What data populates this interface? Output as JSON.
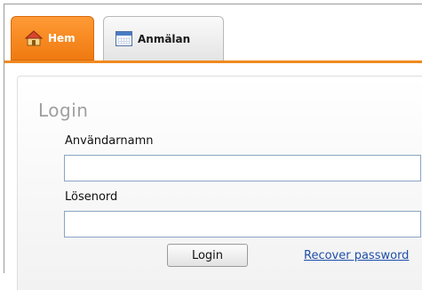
{
  "tabs": [
    {
      "label": "Hem",
      "icon": "house-icon",
      "active": true
    },
    {
      "label": "Anmälan",
      "icon": "calendar-icon",
      "active": false
    }
  ],
  "login": {
    "title": "Login",
    "username_label": "Användarnamn",
    "username_value": "",
    "password_label": "Lösenord",
    "password_value": "",
    "submit_label": "Login",
    "recover_label": "Recover password"
  },
  "colors": {
    "active_tab": "#f08a20",
    "link": "#1f4ea8",
    "title": "#9f9f9f"
  }
}
